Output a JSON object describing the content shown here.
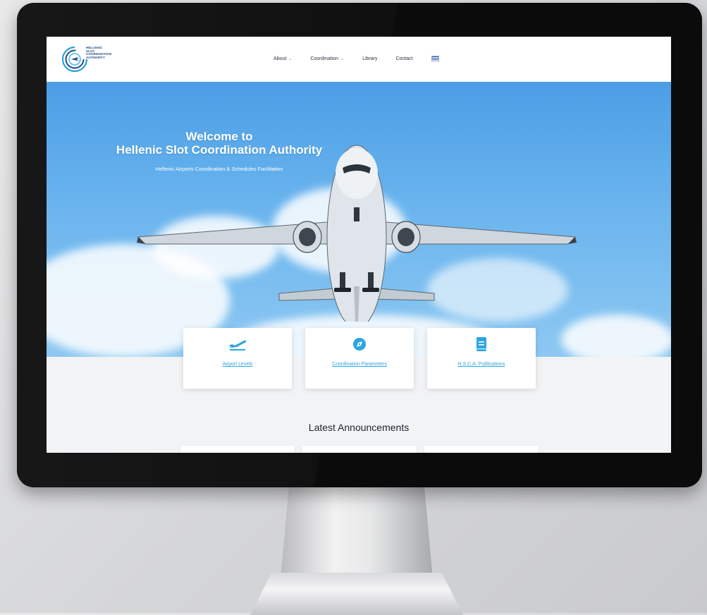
{
  "logo": {
    "lines": [
      "HELLENIC",
      "SLOT",
      "COORDINATION",
      "AUTHORITY"
    ]
  },
  "nav": {
    "items": [
      {
        "label": "About",
        "has_dropdown": true
      },
      {
        "label": "Coordination",
        "has_dropdown": true
      },
      {
        "label": "Library",
        "has_dropdown": false
      },
      {
        "label": "Contact",
        "has_dropdown": false
      }
    ],
    "language_icon": "greek-flag-icon"
  },
  "hero": {
    "title_line1": "Welcome to",
    "title_line2": "Hellenic Slot Coordination Authority",
    "subtitle": "Hellenic Airports Coordination & Schedules Facilitation"
  },
  "cards": [
    {
      "label": "Airport Levels",
      "icon": "airplane-departure-icon"
    },
    {
      "label": "Coordination Parameters",
      "icon": "compass-icon"
    },
    {
      "label": "H.S.C.A. Publications",
      "icon": "book-icon"
    }
  ],
  "announcements": {
    "title": "Latest Announcements"
  },
  "colors": {
    "accent": "#2ba6e0",
    "hero_sky": "#5aa9ea",
    "header_bg": "#ffffff",
    "page_bg": "#f2f3f5"
  }
}
